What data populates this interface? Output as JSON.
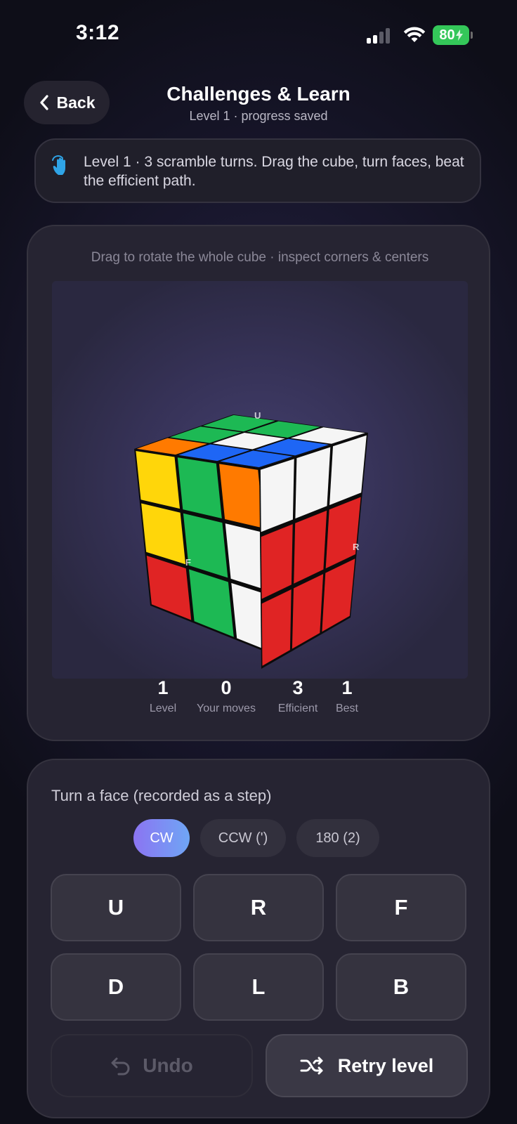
{
  "status_bar": {
    "time": "3:12",
    "battery": "80"
  },
  "header": {
    "back_label": "Back",
    "title": "Challenges & Learn",
    "subtitle": "Level 1 · progress saved"
  },
  "banner": {
    "icon": "tap-hand-icon",
    "text": "Level 1 · 3 scramble turns. Drag the cube, turn faces, beat the efficient path."
  },
  "cube_panel": {
    "hint": "Drag to rotate the whole cube · inspect corners & centers",
    "face_marks": {
      "up": "U",
      "front": "F",
      "right": "R"
    },
    "colors": {
      "white": "#f5f5f5",
      "yellow": "#ffd60a",
      "green": "#1db954",
      "orange": "#ff7a00",
      "blue": "#1e66f5",
      "red": "#e02424"
    },
    "faces": {
      "up": [
        [
          "orange",
          "green",
          "green"
        ],
        [
          "blue",
          "white",
          "green"
        ],
        [
          "blue",
          "blue",
          "white"
        ]
      ],
      "front": [
        [
          "yellow",
          "green",
          "orange"
        ],
        [
          "yellow",
          "green",
          "white"
        ],
        [
          "red",
          "green",
          "white"
        ]
      ],
      "right": [
        [
          "white",
          "white",
          "white"
        ],
        [
          "red",
          "red",
          "red"
        ],
        [
          "red",
          "red",
          "red"
        ]
      ]
    }
  },
  "stats": [
    {
      "value": "1",
      "label": "Level"
    },
    {
      "value": "0",
      "label": "Your moves"
    },
    {
      "value": "3",
      "label": "Efficient"
    },
    {
      "value": "1",
      "label": "Best"
    }
  ],
  "controls": {
    "label": "Turn a face (recorded as a step)",
    "modes": [
      {
        "label": "CW",
        "active": true
      },
      {
        "label": "CCW (')",
        "active": false
      },
      {
        "label": "180 (2)",
        "active": false
      }
    ],
    "faces": [
      "U",
      "R",
      "F",
      "D",
      "L",
      "B"
    ],
    "undo_label": "Undo",
    "retry_label": "Retry level"
  }
}
